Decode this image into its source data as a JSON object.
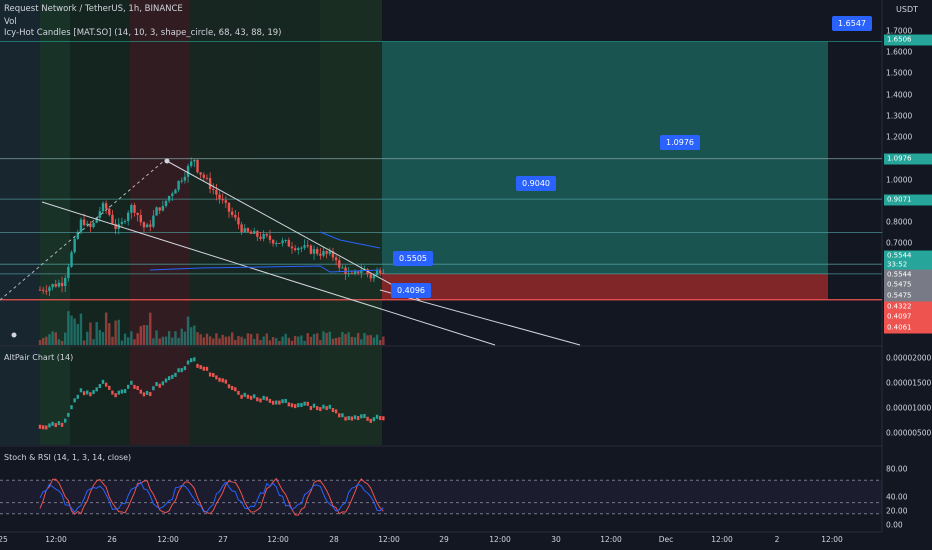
{
  "header": {
    "title": "Request Network / TetherUS, 1h, BINANCE",
    "vol": "Vol",
    "indicator": "Icy-Hot Candles [MAT.SO] (14, 10, 3, shape_circle, 68, 43, 88, 19)"
  },
  "axis": {
    "unit": "USDT",
    "price_ticks": [
      "1.7000",
      "1.6000",
      "1.5000",
      "1.4000",
      "1.3000",
      "1.2000",
      "1.1000",
      "1.0000",
      "0.9000",
      "0.8000",
      "0.7000"
    ],
    "altpair_ticks": [
      "0.00002000",
      "0.00001500",
      "0.00001000",
      "0.00000500"
    ],
    "rsi_ticks": [
      "80.00",
      "40.00",
      "20.00",
      "0.00"
    ],
    "time_ticks": [
      "25",
      "12:00",
      "26",
      "12:00",
      "27",
      "12:00",
      "28",
      "12:00",
      "29",
      "12:00",
      "30",
      "12:00",
      "Dec",
      "12:00",
      "2",
      "12:00"
    ]
  },
  "price_tags": [
    {
      "label": "1.6506",
      "color": "#26a69a"
    },
    {
      "label": "1.0976",
      "color": "#26a69a"
    },
    {
      "label": "0.9071",
      "color": "#26a69a"
    },
    {
      "label": "0.5544",
      "color": "#26a69a"
    },
    {
      "label": "33:52",
      "color": "#26a69a"
    },
    {
      "label": "0.5544",
      "color": "#787b86"
    },
    {
      "label": "0.5475",
      "color": "#787b86"
    },
    {
      "label": "0.5475",
      "color": "#787b86"
    },
    {
      "label": "0.4322",
      "color": "#ef5350"
    },
    {
      "label": "0.4097",
      "color": "#ef5350"
    },
    {
      "label": "0.4061",
      "color": "#ef5350"
    }
  ],
  "callouts": [
    {
      "label": "1.6547"
    },
    {
      "label": "1.0976"
    },
    {
      "label": "0.9040"
    },
    {
      "label": "0.5505"
    },
    {
      "label": "0.4096"
    }
  ],
  "panes": {
    "altpair": "AltPair Chart (14)",
    "rsi": "Stoch & RSI (14, 1, 3, 14, close)"
  },
  "colors": {
    "up": "#26a69a",
    "down": "#ef5350",
    "target_zone": "#1e6a62",
    "stop_zone": "#9c2a2a",
    "callout": "#2962ff",
    "rsi_line": "#2962ff",
    "stoch_line": "#ef5350"
  },
  "chart_data": {
    "type": "candlestick",
    "price_range": [
      0.4,
      1.75
    ],
    "levels": [
      1.6506,
      1.0976,
      0.9071,
      0.75,
      0.6,
      0.5544,
      0.4322
    ],
    "recent_close": 0.5544,
    "entry": 0.5505,
    "stop": 0.4096,
    "targets": [
      0.904,
      1.0976,
      1.6547
    ],
    "altpair_range": [
      4e-06,
      2.1e-05
    ],
    "rsi_range": [
      0,
      100
    ],
    "rsi_bands": [
      80,
      40,
      20
    ]
  }
}
